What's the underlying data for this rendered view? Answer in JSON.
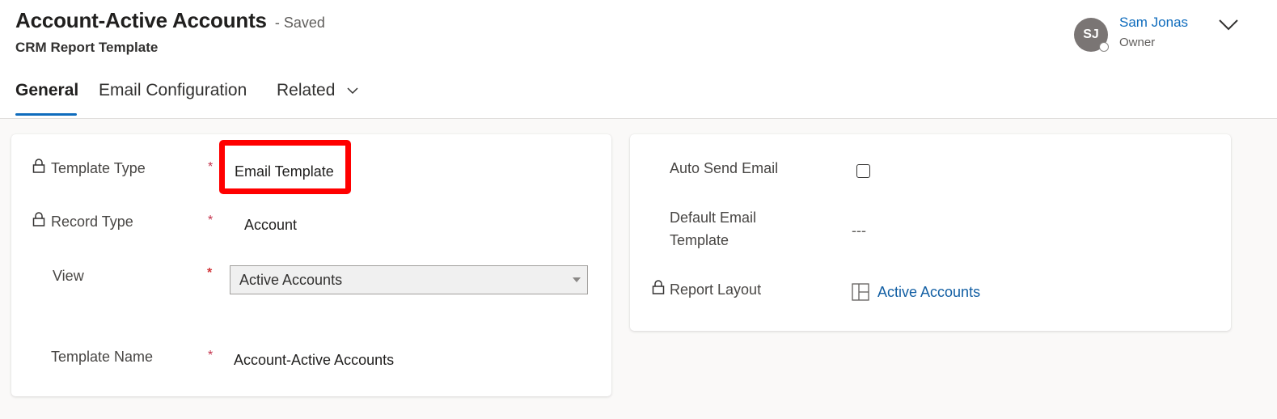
{
  "header": {
    "title": "Account-Active Accounts",
    "saved_status": "- Saved",
    "entity": "CRM Report Template",
    "owner": {
      "initials": "SJ",
      "name": "Sam Jonas",
      "role": "Owner"
    }
  },
  "tabs": [
    {
      "label": "General",
      "active": true
    },
    {
      "label": "Email Configuration",
      "active": false
    },
    {
      "label": "Related",
      "active": false
    }
  ],
  "general": {
    "template_type": {
      "label": "Template Type",
      "required": "*",
      "value": "Email Template"
    },
    "record_type": {
      "label": "Record Type",
      "required": "*",
      "value": "Account"
    },
    "view": {
      "label": "View",
      "required": "*",
      "value": "Active Accounts"
    },
    "template_name": {
      "label": "Template Name",
      "required": "*",
      "value": "Account-Active Accounts"
    }
  },
  "options": {
    "auto_send": {
      "label": "Auto Send Email",
      "checked": false
    },
    "default_email_template": {
      "label_line1": "Default Email",
      "label_line2": "Template",
      "value": "---"
    },
    "report_layout": {
      "label": "Report Layout",
      "value": "Active Accounts"
    }
  },
  "colors": {
    "accent": "#0f6cbd",
    "highlight": "#ff0000",
    "required": "#c4314b"
  }
}
